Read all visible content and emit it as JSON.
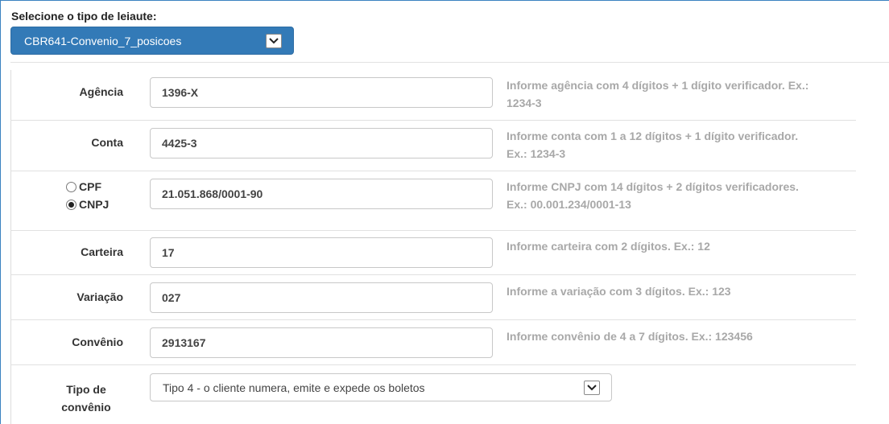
{
  "layout": {
    "label": "Selecione o tipo de leiaute:",
    "selected": "CBR641-Convenio_7_posicoes"
  },
  "fields": {
    "agencia": {
      "label": "Agência",
      "value": "1396-X",
      "help_line1": "Informe agência com 4 dígitos + 1 dígito verificador. Ex.:",
      "help_line2": "1234-3"
    },
    "conta": {
      "label": "Conta",
      "value": "4425-3",
      "help_line1": "Informe conta com 1 a 12 dígitos + 1 dígito verificador.",
      "help_line2": "Ex.: 1234-3"
    },
    "documento": {
      "cpf_label": "CPF",
      "cnpj_label": "CNPJ",
      "selected": "CNPJ",
      "value": "21.051.868/0001-90",
      "help_line1": "Informe CNPJ com 14 dígitos + 2 dígitos verificadores.",
      "help_line2": "Ex.: 00.001.234/0001-13"
    },
    "carteira": {
      "label": "Carteira",
      "value": "17",
      "help": "Informe carteira com 2 dígitos. Ex.: 12"
    },
    "variacao": {
      "label": "Variação",
      "value": "027",
      "help": "Informe a variação com 3 dígitos. Ex.: 123"
    },
    "convenio": {
      "label": "Convênio",
      "value": "2913167",
      "help": "Informe convênio de 4 a 7 dígitos. Ex.: 123456"
    },
    "tipo_convenio": {
      "label_line1": "Tipo de",
      "label_line2": "convênio",
      "selected": "Tipo 4 - o cliente numera, emite e expede os boletos"
    }
  },
  "icons": {
    "dropdown": "chevron-down-icon",
    "radio": "radio-icon"
  },
  "colors": {
    "primary": "#337ab7",
    "help_text": "#a8a8a8"
  }
}
